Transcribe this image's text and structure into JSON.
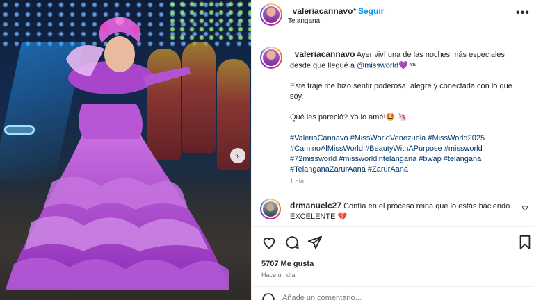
{
  "post": {
    "username": "_valeriacannavo",
    "separator": "•",
    "follow_label": "Seguir",
    "location": "Telangana",
    "more_label": "•••"
  },
  "caption": {
    "username": "_valeriacannavo",
    "line1": "Ayer viví una de las noches más especiales desde que llegué a",
    "mention": "@missworld",
    "heart_emoji": "💜",
    "flag": "VE",
    "para2": "Este traje me hizo sentir poderosa, alegre y conectada con lo que soy.",
    "para3": "Qué les pareció? Yo lo amé!🤩 🦄",
    "hashtags": [
      "#ValeriaCannavo",
      "#MissWorldVenezuela",
      "#MissWorld2025",
      "#CaminoAlMissWorld",
      "#BeautyWithAPurpose",
      "#missworld",
      "#72missworld",
      "#missworldintelangana",
      "#bwap",
      "#telangana",
      "#TelanganaZarurAana",
      "#ZarurAana"
    ],
    "time": "1 día"
  },
  "comment": {
    "username": "drmanuelc27",
    "text": "Confía en el proceso reina que lo estás haciendo EXCELENTE",
    "emoji": "💔"
  },
  "stats": {
    "likes": "5707 Me gusta",
    "posted": "Hace un día"
  },
  "add_comment": {
    "placeholder": "Añade un comentario..."
  },
  "icons": {
    "like": "heart-icon",
    "comment": "comment-icon",
    "share": "share-icon",
    "save": "bookmark-icon",
    "next": "chevron-right-icon"
  },
  "colors": {
    "link": "#00376b",
    "follow": "#0095f6",
    "text": "#262626",
    "muted": "#8e8e8e"
  }
}
